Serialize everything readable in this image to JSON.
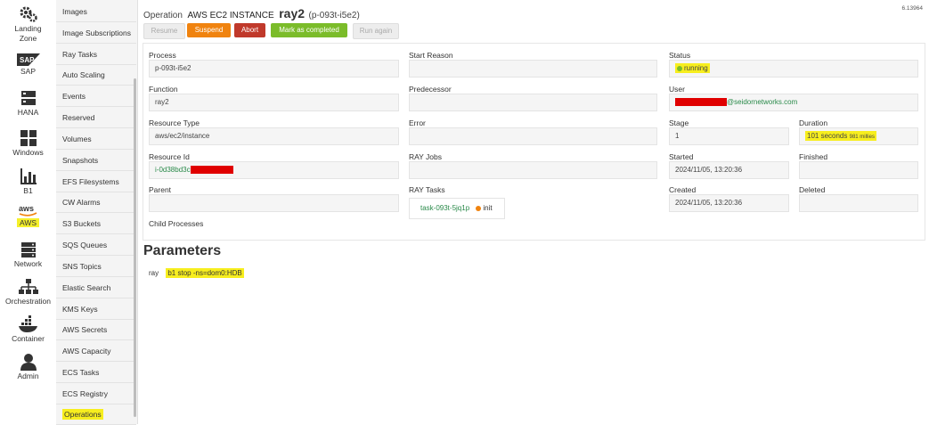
{
  "rail": [
    {
      "label": "Landing\nZone",
      "icon": "gear-icon"
    },
    {
      "label": "SAP",
      "icon": "sap-logo-icon"
    },
    {
      "label": "HANA",
      "icon": "hana-server-icon"
    },
    {
      "label": "Windows",
      "icon": "windows-icon"
    },
    {
      "label": "B1",
      "icon": "bar-chart-icon"
    },
    {
      "label": "AWS",
      "icon": "aws-logo-icon"
    },
    {
      "label": "Network",
      "icon": "network-icon"
    },
    {
      "label": "Orchestration",
      "icon": "orchestration-icon"
    },
    {
      "label": "Container",
      "icon": "docker-icon"
    },
    {
      "label": "Admin",
      "icon": "user-icon"
    }
  ],
  "submenu": [
    "Images",
    "Image Subscriptions",
    "Ray Tasks",
    "Auto Scaling",
    "Events",
    "Reserved",
    "Volumes",
    "Snapshots",
    "EFS Filesystems",
    "CW Alarms",
    "S3 Buckets",
    "SQS Queues",
    "SNS Topics",
    "Elastic Search",
    "KMS Keys",
    "AWS Secrets",
    "AWS Capacity",
    "ECS Tasks",
    "ECS Registry",
    "Operations"
  ],
  "version": "6.13964",
  "header": {
    "operation_label": "Operation",
    "resource_kind": "AWS EC2 INSTANCE",
    "name": "ray2",
    "id": "(p-093t-i5e2)"
  },
  "buttons": {
    "resume": "Resume",
    "suspend": "Suspend",
    "abort": "Abort",
    "complete": "Mark as completed",
    "run_again": "Run again"
  },
  "fields": {
    "process": {
      "label": "Process",
      "value": "p-093t-i5e2"
    },
    "start_reason": {
      "label": "Start Reason",
      "value": ""
    },
    "status": {
      "label": "Status",
      "value": "running"
    },
    "function": {
      "label": "Function",
      "value": "ray2"
    },
    "predecessor": {
      "label": "Predecessor",
      "value": ""
    },
    "user": {
      "label": "User",
      "value": "@seidornetworks.com"
    },
    "resource_type": {
      "label": "Resource Type",
      "value": "aws/ec2/instance"
    },
    "error": {
      "label": "Error",
      "value": ""
    },
    "stage": {
      "label": "Stage",
      "value": "1"
    },
    "duration": {
      "label": "Duration",
      "value": "101 seconds",
      "ms": "981 millies"
    },
    "resource_id": {
      "label": "Resource Id",
      "value": "i-0d38bd3c"
    },
    "ray_jobs": {
      "label": "RAY Jobs",
      "value": ""
    },
    "started": {
      "label": "Started",
      "value": "2024/11/05, 13:20:36"
    },
    "finished": {
      "label": "Finished",
      "value": ""
    },
    "parent": {
      "label": "Parent",
      "value": ""
    },
    "ray_tasks": {
      "label": "RAY Tasks",
      "task": "task-093t-5jq1p",
      "task_status": "init"
    },
    "created": {
      "label": "Created",
      "value": "2024/11/05, 13:20:36"
    },
    "deleted": {
      "label": "Deleted",
      "value": ""
    },
    "child_processes": {
      "label": "Child Processes"
    }
  },
  "parameters": {
    "title": "Parameters",
    "key": "ray",
    "value": "b1 stop -ns=dom0:HDB"
  },
  "colors": {
    "suspend": "#f0830f",
    "abort": "#c0392b",
    "complete": "#7bbc2a",
    "status_running": "#7bbc2a",
    "task_init": "#f0830f",
    "highlight": "#f7ee1e",
    "link": "#2a8a4a"
  }
}
